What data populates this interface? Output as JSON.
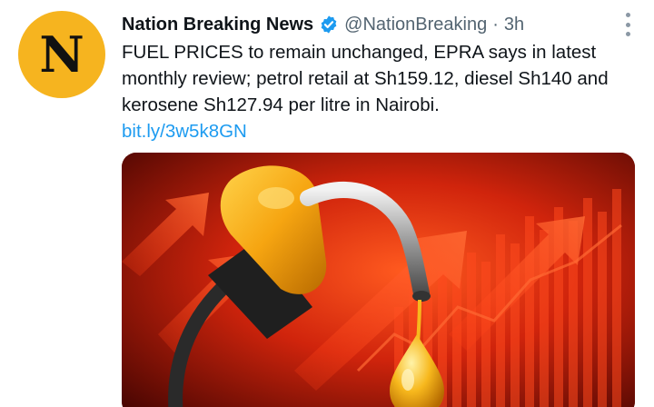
{
  "tweet": {
    "avatar_letter": "N",
    "display_name": "Nation Breaking News",
    "handle": "@NationBreaking",
    "separator": "·",
    "time": "3h",
    "text": "FUEL PRICES to remain unchanged, EPRA says in latest monthly review; petrol retail at Sh159.12, diesel Sh140 and kerosene Sh127.94 per litre in Nairobi.",
    "link": "bit.ly/3w5k8GN",
    "icons": {
      "verified": "verified-badge-icon",
      "more": "more-options-icon"
    },
    "colors": {
      "avatar_bg": "#f6b41f",
      "link": "#1d9bf0",
      "verified": "#1d9bf0",
      "media_bg": "#6b0a04"
    }
  }
}
